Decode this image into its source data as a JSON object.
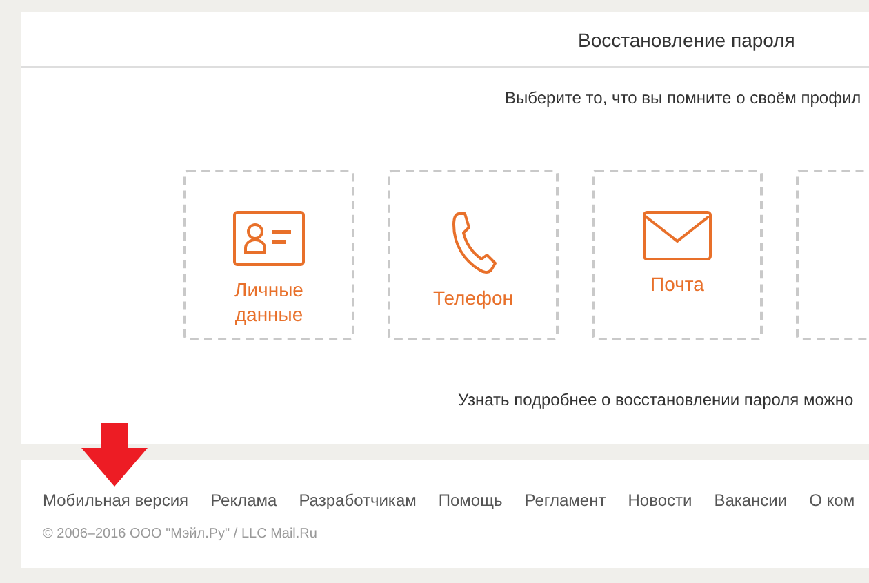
{
  "header": {
    "title": "Восстановление пароля"
  },
  "prompt": "Выберите то, что вы помните о своём профил",
  "options": [
    {
      "kind": "personal",
      "label": "Личные данные"
    },
    {
      "kind": "phone",
      "label": "Телефон"
    },
    {
      "kind": "mail",
      "label": "Почта"
    },
    {
      "kind": "hidden"
    }
  ],
  "info": "Узнать подробнее о восстановлении пароля можно",
  "footer": {
    "links": [
      "Мобильная версия",
      "Реклама",
      "Разработчикам",
      "Помощь",
      "Регламент",
      "Новости",
      "Вакансии",
      "О ком"
    ],
    "copyright": "© 2006–2016 ООО \"Мэйл.Ру\" / LLC Mail.Ru"
  }
}
